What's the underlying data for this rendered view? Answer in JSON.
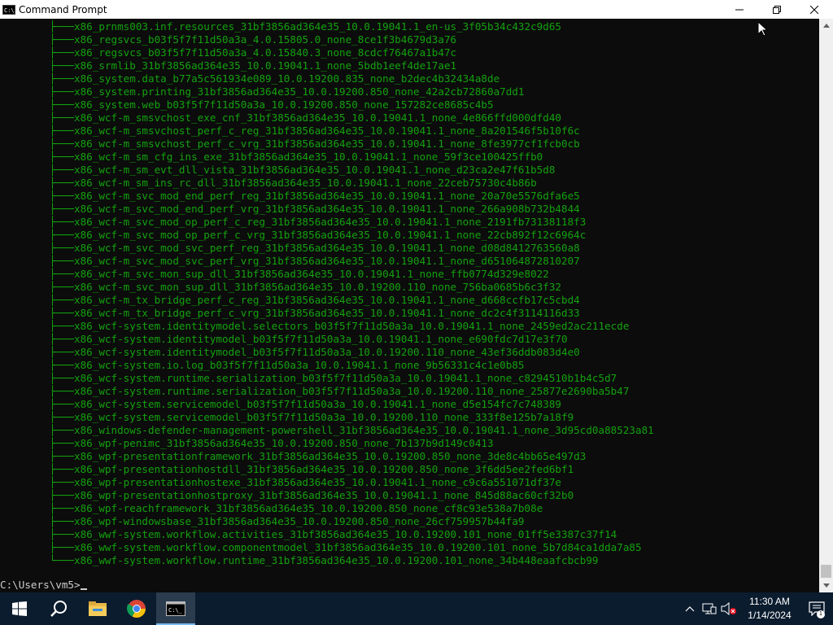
{
  "window": {
    "title": "Command Prompt",
    "icon_text": "C:\\_",
    "controls": [
      "minimize",
      "restore",
      "close"
    ]
  },
  "console": {
    "text_color": "#13a10e",
    "tree_branch": "├───",
    "tree_last": "└───",
    "lines": [
      "x86_prnms003.inf.resources_31bf3856ad364e35_10.0.19041.1_en-us_3f05b34c432c9d65",
      "x86_regsvcs_b03f5f7f11d50a3a_4.0.15805.0_none_8ce1f3b4679d3a76",
      "x86_regsvcs_b03f5f7f11d50a3a_4.0.15840.3_none_8cdcf76467a1b47c",
      "x86_srmlib_31bf3856ad364e35_10.0.19041.1_none_5bdb1eef4de17ae1",
      "x86_system.data_b77a5c561934e089_10.0.19200.835_none_b2dec4b32434a8de",
      "x86_system.printing_31bf3856ad364e35_10.0.19200.850_none_42a2cb72860a7dd1",
      "x86_system.web_b03f5f7f11d50a3a_10.0.19200.850_none_157282ce8685c4b5",
      "x86_wcf-m_smsvchost_exe_cnf_31bf3856ad364e35_10.0.19041.1_none_4e866ffd000dfd40",
      "x86_wcf-m_smsvchost_perf_c_reg_31bf3856ad364e35_10.0.19041.1_none_8a201546f5b10f6c",
      "x86_wcf-m_smsvchost_perf_c_vrg_31bf3856ad364e35_10.0.19041.1_none_8fe3977cf1fcb0cb",
      "x86_wcf-m_sm_cfg_ins_exe_31bf3856ad364e35_10.0.19041.1_none_59f3ce100425ffb0",
      "x86_wcf-m_sm_evt_dll_vista_31bf3856ad364e35_10.0.19041.1_none_d23ca2e47f61b5d8",
      "x86_wcf-m_sm_ins_rc_dll_31bf3856ad364e35_10.0.19041.1_none_22ceb75730c4b86b",
      "x86_wcf-m_svc_mod_end_perf_reg_31bf3856ad364e35_10.0.19041.1_none_20a70e5576dfa6e5",
      "x86_wcf-m_svc_mod_end_perf_vrg_31bf3856ad364e35_10.0.19041.1_none_266a908b732b4844",
      "x86_wcf-m_svc_mod_op_perf_c_reg_31bf3856ad364e35_10.0.19041.1_none_2191fb73138118f3",
      "x86_wcf-m_svc_mod_op_perf_c_vrg_31bf3856ad364e35_10.0.19041.1_none_22cb892f12c6964c",
      "x86_wcf-m_svc_mod_svc_perf_reg_31bf3856ad364e35_10.0.19041.1_none_d08d8412763560a8",
      "x86_wcf-m_svc_mod_svc_perf_vrg_31bf3856ad364e35_10.0.19041.1_none_d651064872810207",
      "x86_wcf-m_svc_mon_sup_dll_31bf3856ad364e35_10.0.19041.1_none_ffb0774d329e8022",
      "x86_wcf-m_svc_mon_sup_dll_31bf3856ad364e35_10.0.19200.110_none_756ba0685b6c3f32",
      "x86_wcf-m_tx_bridge_perf_c_reg_31bf3856ad364e35_10.0.19041.1_none_d668ccfb17c5cbd4",
      "x86_wcf-m_tx_bridge_perf_c_vrg_31bf3856ad364e35_10.0.19041.1_none_dc2c4f3114116d33",
      "x86_wcf-system.identitymodel.selectors_b03f5f7f11d50a3a_10.0.19041.1_none_2459ed2ac211ecde",
      "x86_wcf-system.identitymodel_b03f5f7f11d50a3a_10.0.19041.1_none_e690fdc7d17e3f70",
      "x86_wcf-system.identitymodel_b03f5f7f11d50a3a_10.0.19200.110_none_43ef36ddb083d4e0",
      "x86_wcf-system.io.log_b03f5f7f11d50a3a_10.0.19041.1_none_9b56331c4c1e0b85",
      "x86_wcf-system.runtime.serialization_b03f5f7f11d50a3a_10.0.19041.1_none_c8294510b1b4c5d7",
      "x86_wcf-system.runtime.serialization_b03f5f7f11d50a3a_10.0.19200.110_none_25877e2690ba5b47",
      "x86_wcf-system.servicemodel_b03f5f7f11d50a3a_10.0.19041.1_none_d5e154fc7c748389",
      "x86_wcf-system.servicemodel_b03f5f7f11d50a3a_10.0.19200.110_none_333f8e125b7a18f9",
      "x86_windows-defender-management-powershell_31bf3856ad364e35_10.0.19041.1_none_3d95cd0a88523a81",
      "x86_wpf-penimc_31bf3856ad364e35_10.0.19200.850_none_7b137b9d149c0413",
      "x86_wpf-presentationframework_31bf3856ad364e35_10.0.19200.850_none_3de8c4bb65e497d3",
      "x86_wpf-presentationhostdll_31bf3856ad364e35_10.0.19200.850_none_3f6dd5ee2fed6bf1",
      "x86_wpf-presentationhostexe_31bf3856ad364e35_10.0.19041.1_none_c9c6a551071df37e",
      "x86_wpf-presentationhostproxy_31bf3856ad364e35_10.0.19041.1_none_845d88ac60cf32b0",
      "x86_wpf-reachframework_31bf3856ad364e35_10.0.19200.850_none_cf8c93e538a7b08e",
      "x86_wpf-windowsbase_31bf3856ad364e35_10.0.19200.850_none_26cf759957b44fa9",
      "x86_wwf-system.workflow.activities_31bf3856ad364e35_10.0.19200.101_none_01ff5e3387c37f14",
      "x86_wwf-system.workflow.componentmodel_31bf3856ad364e35_10.0.19200.101_none_5b7d84ca1dda7a85",
      "x86_wwf-system.workflow.runtime_31bf3856ad364e35_10.0.19200.101_none_34b448eaafcbcb99"
    ],
    "prompt": "C:\\Users\\vm5>"
  },
  "taskbar": {
    "apps": [
      "start-icon",
      "search-icon",
      "file-explorer-icon",
      "chrome-icon",
      "command-prompt-icon"
    ],
    "accent": "#0b1c2e"
  },
  "tray": {
    "time": "11:30 AM",
    "date": "1/14/2024",
    "notification_count": "1"
  }
}
